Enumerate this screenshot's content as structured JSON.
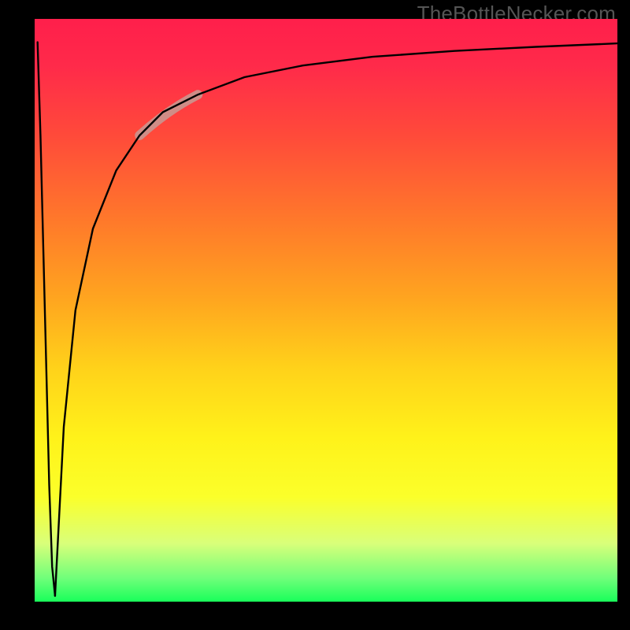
{
  "watermark": "TheBottleNecker.com",
  "chart_data": {
    "type": "line",
    "title": "",
    "xlabel": "",
    "ylabel": "",
    "xlim": [
      0,
      100
    ],
    "ylim": [
      0,
      100
    ],
    "grid": false,
    "background_gradient": {
      "direction": "vertical",
      "stops": [
        {
          "pos": 0,
          "color": "#ff1f4b"
        },
        {
          "pos": 35,
          "color": "#ff7a2a"
        },
        {
          "pos": 60,
          "color": "#ffd21a"
        },
        {
          "pos": 82,
          "color": "#fbff2a"
        },
        {
          "pos": 100,
          "color": "#19ff5a"
        }
      ]
    },
    "series": [
      {
        "name": "bottleneck-curve-down",
        "color": "#000000",
        "x": [
          0.5,
          1.0,
          1.5,
          2.0,
          2.5,
          3.0,
          3.5
        ],
        "y": [
          96,
          80,
          60,
          40,
          20,
          6,
          1
        ]
      },
      {
        "name": "bottleneck-curve-up",
        "color": "#000000",
        "x": [
          3.5,
          5,
          7,
          10,
          14,
          18,
          22,
          28,
          36,
          46,
          58,
          72,
          86,
          100
        ],
        "y": [
          1,
          30,
          50,
          64,
          74,
          80,
          84,
          87,
          90,
          92,
          93.5,
          94.5,
          95.2,
          95.8
        ]
      }
    ],
    "highlight": {
      "name": "highlight-segment",
      "color": "#cf8d87",
      "thickness": 12,
      "x_range": [
        18,
        28
      ],
      "y_range": [
        80,
        87
      ]
    }
  }
}
